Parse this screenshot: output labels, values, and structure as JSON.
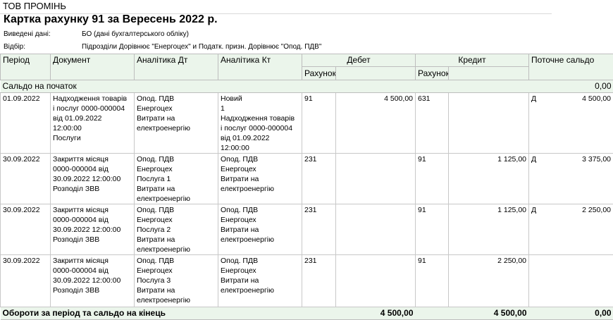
{
  "organization": "ТОВ ПРОМІНЬ",
  "report_title": "Картка рахунку 91 за Вересень 2022 р.",
  "meta": [
    {
      "label": "Виведені дані:",
      "value": "БО (дані бухгалтерського обліку)"
    },
    {
      "label": "Відбір:",
      "value": "Підрозділи Дорівнює \"Енергоцех\" и Податк. призн. Дорівнює \"Опод. ПДВ\""
    }
  ],
  "columns": {
    "period": "Період",
    "document": "Документ",
    "analytics_dt": "Аналітика Дт",
    "analytics_kt": "Аналітика Кт",
    "debit": "Дебет",
    "credit": "Кредит",
    "balance": "Поточне сальдо",
    "account": "Рахунок"
  },
  "opening": {
    "label": "Сальдо на початок",
    "value": "0,00"
  },
  "rows": [
    {
      "period": "01.09.2022",
      "document": [
        "Надходження товарів",
        "і послуг 0000-000004",
        "від 01.09.2022",
        "12:00:00",
        "Послуги"
      ],
      "analytics_dt": [
        "Опод. ПДВ",
        "Енергоцех",
        "Витрати на",
        "електроенергію"
      ],
      "analytics_kt": [
        "Новий",
        "1",
        "Надходження товарів",
        "і послуг 0000-000004",
        "від 01.09.2022",
        "12:00:00"
      ],
      "debit_account": "91",
      "debit_amount": "4 500,00",
      "credit_account": "631",
      "credit_amount": "",
      "balance_side": "Д",
      "balance": "4 500,00"
    },
    {
      "period": "30.09.2022",
      "document": [
        "Закриття місяця",
        "0000-000004 від",
        "30.09.2022 12:00:00",
        "Розподіл ЗВВ"
      ],
      "analytics_dt": [
        "Опод. ПДВ",
        "Енергоцех",
        "Послуга 1",
        "Витрати на",
        "електроенергію"
      ],
      "analytics_kt": [
        "Опод. ПДВ",
        "Енергоцех",
        "Витрати на",
        "електроенергію"
      ],
      "debit_account": "231",
      "debit_amount": "",
      "credit_account": "91",
      "credit_amount": "1 125,00",
      "balance_side": "Д",
      "balance": "3 375,00"
    },
    {
      "period": "30.09.2022",
      "document": [
        "Закриття місяця",
        "0000-000004 від",
        "30.09.2022 12:00:00",
        "Розподіл ЗВВ"
      ],
      "analytics_dt": [
        "Опод. ПДВ",
        "Енергоцех",
        "Послуга 2",
        "Витрати на",
        "електроенергію"
      ],
      "analytics_kt": [
        "Опод. ПДВ",
        "Енергоцех",
        "Витрати на",
        "електроенергію"
      ],
      "debit_account": "231",
      "debit_amount": "",
      "credit_account": "91",
      "credit_amount": "1 125,00",
      "balance_side": "Д",
      "balance": "2 250,00"
    },
    {
      "period": "30.09.2022",
      "document": [
        "Закриття місяця",
        "0000-000004 від",
        "30.09.2022 12:00:00",
        "Розподіл ЗВВ"
      ],
      "analytics_dt": [
        "Опод. ПДВ",
        "Енергоцех",
        "Послуга 3",
        "Витрати на",
        "електроенергію"
      ],
      "analytics_kt": [
        "Опод. ПДВ",
        "Енергоцех",
        "Витрати на",
        "електроенергію"
      ],
      "debit_account": "231",
      "debit_amount": "",
      "credit_account": "91",
      "credit_amount": "2 250,00",
      "balance_side": "",
      "balance": ""
    }
  ],
  "totals": {
    "label": "Обороти за період та сальдо на кінець",
    "debit": "4 500,00",
    "credit": "4 500,00",
    "balance": "0,00"
  }
}
